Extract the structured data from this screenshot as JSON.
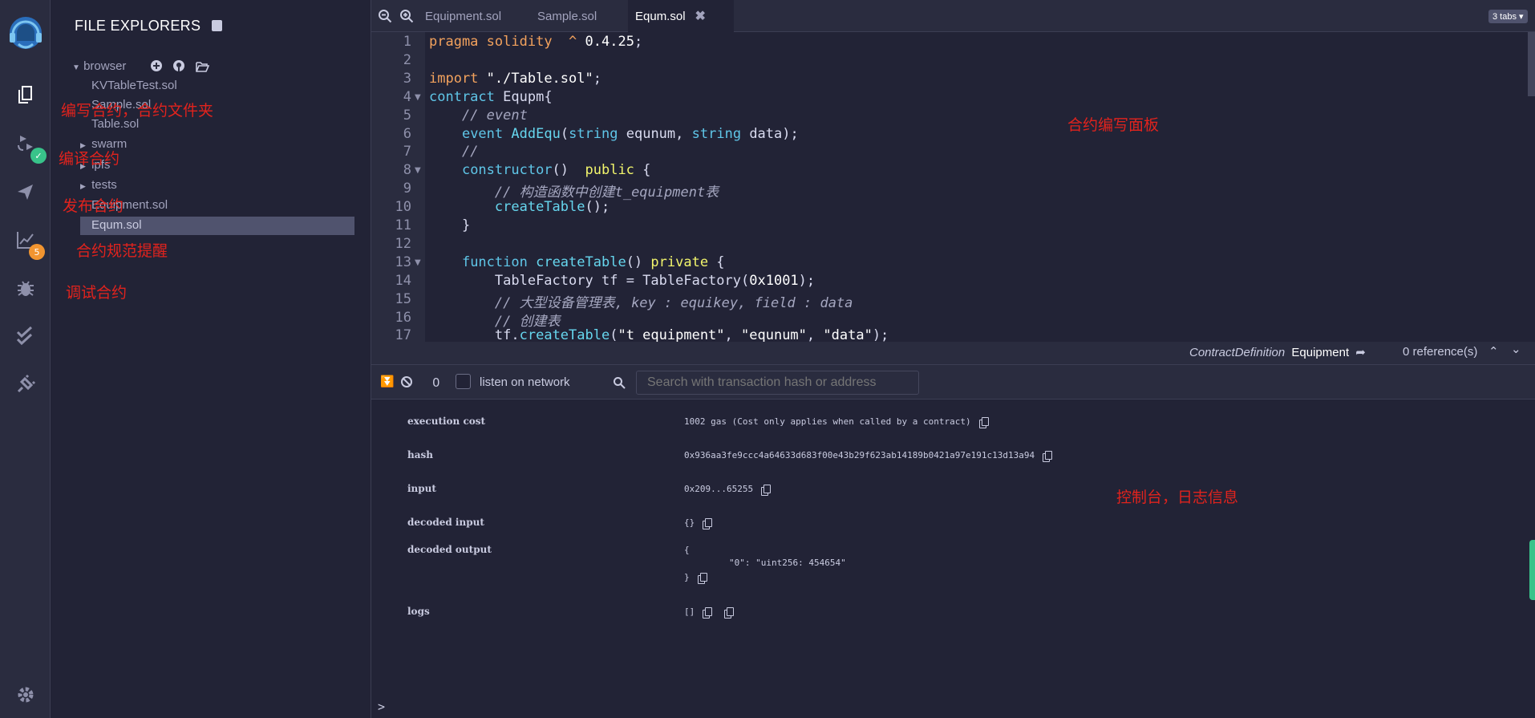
{
  "file_explorer": {
    "title": "FILE EXPLORERS",
    "workspace": "browser",
    "files": [
      "KVTableTest.sol",
      "Sample.sol",
      "Table.sol"
    ],
    "folders": [
      "swarm",
      "ipfs",
      "tests"
    ],
    "bottom_files": [
      "Equipment.sol",
      "Equm.sol"
    ],
    "selected_file": "Equm.sol"
  },
  "iconbar": {
    "analysis_badge": "5"
  },
  "tabs": [
    {
      "label": "Equipment.sol",
      "active": false
    },
    {
      "label": "Sample.sol",
      "active": false
    },
    {
      "label": "Equm.sol",
      "active": true
    }
  ],
  "tabs_count": "3 tabs",
  "code_lines": [
    "pragma solidity  ^ 0.4.25;",
    "",
    "import \"./Table.sol\";",
    "contract Equpm{",
    "    // event",
    "    event AddEqu(string equnum, string data);",
    "    //",
    "    constructor()  public {",
    "        // 构造函数中创建t_equipment表",
    "        createTable();",
    "    }",
    "",
    "    function createTable() private {",
    "        TableFactory tf = TableFactory(0x1001);",
    "        // 大型设备管理表, key : equikey, field : data",
    "        // 创建表",
    "        tf.createTable(\"t_equipment\", \"equnum\", \"data\");"
  ],
  "definition_bar": {
    "kind": "ContractDefinition",
    "name": "Equipment",
    "references": "0 reference(s)"
  },
  "terminal": {
    "pending_count": "0",
    "listen_label": "listen on network",
    "search_placeholder": "Search with transaction hash or address",
    "rows": {
      "execution_cost": {
        "key": "execution cost",
        "value": "1002 gas (Cost only applies when called by a contract)"
      },
      "hash": {
        "key": "hash",
        "value": "0x936aa3fe9ccc4a64633d683f00e43b29f623ab14189b0421a97e191c13d13a94"
      },
      "input": {
        "key": "input",
        "value": "0x209...65255"
      },
      "decoded_input": {
        "key": "decoded input",
        "value": "{}"
      },
      "decoded_output": {
        "key": "decoded output",
        "open": "{",
        "line": "\"0\": \"uint256: 454654\"",
        "close": "}"
      },
      "logs": {
        "key": "logs",
        "value": "[]"
      }
    },
    "prompt": ">"
  },
  "annotations": {
    "write": "编写合约，合约文件夹",
    "compile": "编译合约",
    "deploy": "发布合约",
    "lint": "合约规范提醒",
    "debug": "调试合约",
    "editor_panel": "合约编写面板",
    "console": "控制台，日志信息"
  },
  "colors": {
    "accent": "#2a6ebb",
    "annotation": "#e1231d",
    "badge_orange": "#f29530",
    "badge_green": "#38c38a"
  }
}
